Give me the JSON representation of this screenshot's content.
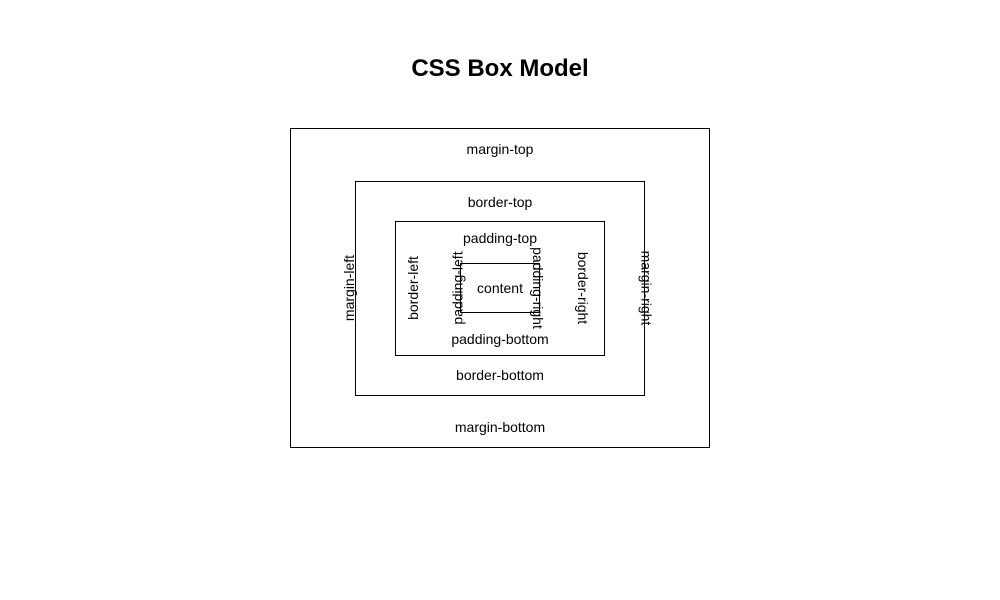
{
  "title": "CSS Box Model",
  "layers": {
    "margin": {
      "top": "margin-top",
      "right": "margin-right",
      "bottom": "margin-bottom",
      "left": "margin-left"
    },
    "border": {
      "top": "border-top",
      "right": "border-right",
      "bottom": "border-bottom",
      "left": "border-left"
    },
    "padding": {
      "top": "padding-top",
      "right": "padding-right",
      "bottom": "padding-bottom",
      "left": "padding-left"
    },
    "content": "content"
  }
}
